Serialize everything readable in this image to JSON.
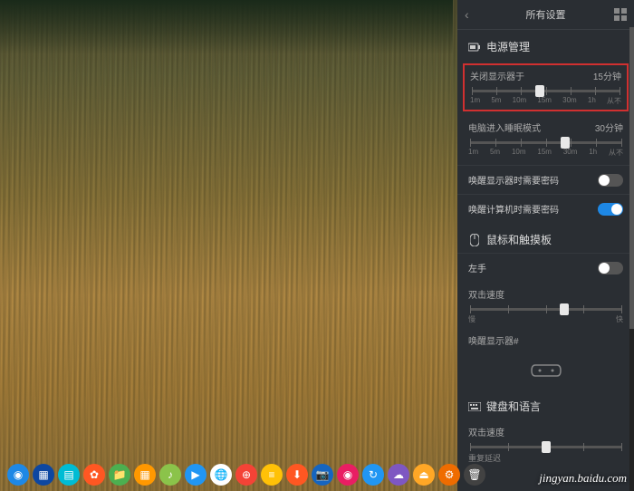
{
  "header": {
    "title": "所有设置"
  },
  "power": {
    "title": "电源管理",
    "display_off": {
      "label": "关闭显示器于",
      "value": "15分钟",
      "thumb_pct": 46,
      "ticks": [
        "1m",
        "5m",
        "10m",
        "15m",
        "30m",
        "1h",
        "从不"
      ]
    },
    "sleep": {
      "label": "电脑进入睡眠模式",
      "value": "30分钟",
      "thumb_pct": 63,
      "ticks": [
        "1m",
        "5m",
        "10m",
        "15m",
        "30m",
        "1h",
        "从不"
      ]
    },
    "wake_display_pw": {
      "label": "唤醒显示器时需要密码",
      "on": false
    },
    "wake_computer_pw": {
      "label": "唤醒计算机时需要密码",
      "on": true
    }
  },
  "mouse": {
    "title": "鼠标和触摸板",
    "left_hand": {
      "label": "左手",
      "on": false
    },
    "dbl_click": {
      "label": "双击速度",
      "thumb_pct": 62,
      "low": "慢",
      "high": "快"
    },
    "wake_display": {
      "label": "唤醒显示器#"
    }
  },
  "keyboard": {
    "title": "键盘和语言",
    "repeat": {
      "label": "双击速度",
      "sub": "重复延迟",
      "thumb_pct": 50
    }
  },
  "watermark": "jingyan.baidu.com",
  "dock": [
    {
      "c": "#1e88e5",
      "g": "◉"
    },
    {
      "c": "#0d47a1",
      "g": "▦"
    },
    {
      "c": "#00bcd4",
      "g": "▤"
    },
    {
      "c": "#ff5722",
      "g": "✿"
    },
    {
      "c": "#4caf50",
      "g": "📁"
    },
    {
      "c": "#ff9800",
      "g": "▦"
    },
    {
      "c": "#8bc34a",
      "g": "♪"
    },
    {
      "c": "#2196f3",
      "g": "▶"
    },
    {
      "c": "#fff",
      "g": "🌐"
    },
    {
      "c": "#f44336",
      "g": "⊕"
    },
    {
      "c": "#ffc107",
      "g": "≡"
    },
    {
      "c": "#ff5722",
      "g": "⬇"
    },
    {
      "c": "#1565c0",
      "g": "📷"
    },
    {
      "c": "#e91e63",
      "g": "◉"
    },
    {
      "c": "#2196f3",
      "g": "↻"
    },
    {
      "c": "#7e57c2",
      "g": "☁"
    },
    {
      "c": "#ffa726",
      "g": "⏏"
    },
    {
      "c": "#ef6c00",
      "g": "⚙"
    },
    {
      "c": "#424242",
      "g": "🗑"
    }
  ]
}
